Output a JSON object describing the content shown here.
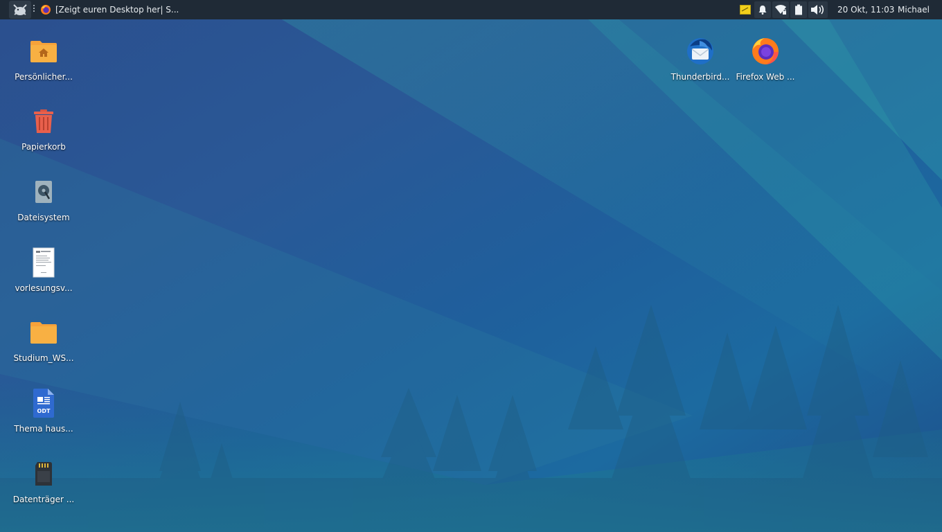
{
  "panel": {
    "task_title": "[Zeigt euren Desktop her| S...",
    "clock": "20 Okt, 11:03",
    "user": "Michael",
    "tray_icons": [
      "notes-icon",
      "bell-icon",
      "wifi-icon",
      "battery-icon",
      "volume-icon"
    ]
  },
  "desktop": {
    "left_icons": [
      {
        "label": "Persönlicher...",
        "icon": "home-folder-icon"
      },
      {
        "label": "Papierkorb",
        "icon": "trash-icon"
      },
      {
        "label": "Dateisystem",
        "icon": "harddisk-icon"
      },
      {
        "label": "vorlesungsv...",
        "icon": "pdf-document-icon"
      },
      {
        "label": "Studium_WS...",
        "icon": "folder-icon"
      },
      {
        "label": "Thema haus...",
        "icon": "odt-document-icon"
      },
      {
        "label": "Datenträger ...",
        "icon": "sd-card-icon"
      }
    ],
    "right_icons": [
      {
        "label": "Thunderbird...",
        "icon": "thunderbird-icon"
      },
      {
        "label": "Firefox Web ...",
        "icon": "firefox-icon"
      }
    ]
  },
  "colors": {
    "panel_bg": "#1f2a36",
    "folder_orange": "#f6a23a",
    "trash_red": "#e8604c",
    "wallpaper_blue": "#2a5896",
    "wallpaper_teal": "#1d7a9a"
  }
}
